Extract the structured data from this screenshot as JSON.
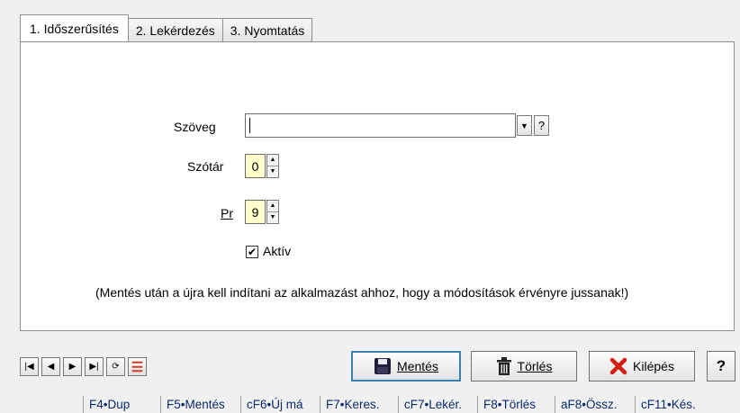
{
  "tabs": [
    {
      "label": "1. Időszerűsítés",
      "active": true
    },
    {
      "label": "2. Lekérdezés",
      "active": false
    },
    {
      "label": "3. Nyomtatás",
      "active": false
    }
  ],
  "form": {
    "text_label": "Szöveg",
    "text_value": "",
    "dropdown_glyph": "▼",
    "help_small": "?",
    "dict_label": "Szótár",
    "dict_value": "0",
    "pr_label": "Pr",
    "pr_value": "9",
    "spin_up": "▲",
    "spin_down": "▼",
    "active_label": "Aktív",
    "active_checked": true,
    "check_glyph": "✔",
    "note": "(Mentés után a újra kell indítani az alkalmazást ahhoz, hogy a módosítások érvényre jussanak!)"
  },
  "nav": {
    "first": "|◀",
    "prev": "◀",
    "next": "▶",
    "last": "▶|",
    "refresh": "⟳",
    "list": "☰"
  },
  "buttons": {
    "save": "Mentés",
    "delete": "Törlés",
    "exit": "Kilépés",
    "help": "?"
  },
  "icons": {
    "save": "floppy-disk-icon",
    "delete": "trash-can-icon",
    "exit": "red-x-icon"
  },
  "colors": {
    "spin_field_bg": "#ffffcc",
    "exit_icon": "#d21f12",
    "fkey_text": "#0c2a6e",
    "primary_border": "#3c7fb1"
  },
  "fkeys": [
    "F4•Dup",
    "F5•Mentés",
    "cF6•Új má",
    "F7•Keres.",
    "cF7•Lekér.",
    "F8•Törlés",
    "aF8•Össz.",
    "cF11•Kés."
  ]
}
